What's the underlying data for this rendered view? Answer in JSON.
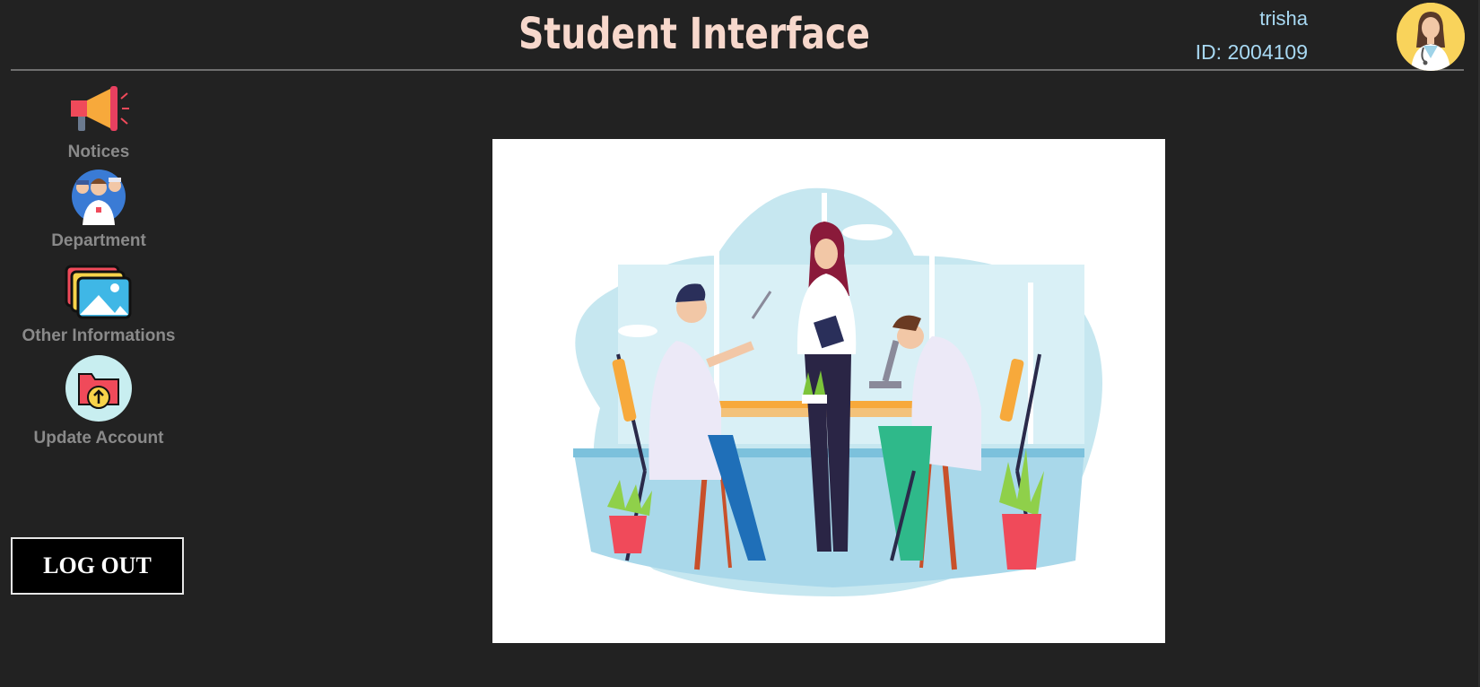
{
  "header": {
    "title": "Student Interface"
  },
  "user": {
    "name": "trisha",
    "id_text": "ID: 2004109",
    "avatar_icon": "doctor-avatar-icon"
  },
  "sidebar": {
    "items": [
      {
        "label": "Notices",
        "icon": "megaphone-icon"
      },
      {
        "label": "Department",
        "icon": "doctors-group-icon"
      },
      {
        "label": "Other Informations",
        "icon": "photo-gallery-icon"
      },
      {
        "label": "Update Account",
        "icon": "upload-folder-icon"
      }
    ],
    "logout_label": "LOG OUT"
  },
  "hero": {
    "illustration": "medical-lab-illustration"
  },
  "colors": {
    "background": "#222222",
    "title": "#f7d8cc",
    "user_text": "#a8d9f3",
    "nav_label": "#8a8a8a"
  }
}
